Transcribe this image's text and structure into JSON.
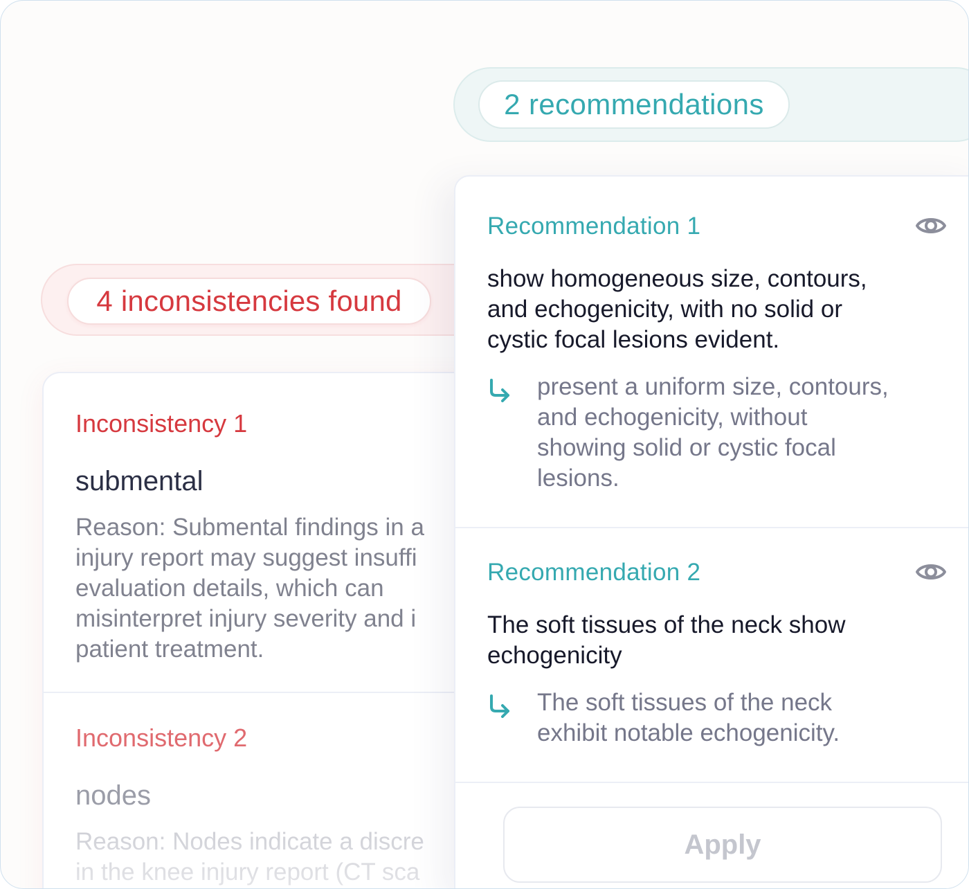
{
  "inconsistencies": {
    "badge": "4 inconsistencies found",
    "items": [
      {
        "title": "Inconsistency 1",
        "term": "submental",
        "reason_lines": [
          "Reason: Submental findings in a",
          "injury report may suggest insuffi",
          "evaluation details, which can",
          "misinterpret injury severity and i",
          "patient treatment."
        ]
      },
      {
        "title": "Inconsistency 2",
        "term": "nodes",
        "reason_lines": [
          "Reason: Nodes indicate a discre",
          "in the knee injury report (CT sca"
        ]
      }
    ]
  },
  "recommendations": {
    "badge": "2 recommendations",
    "items": [
      {
        "title": "Recommendation 1",
        "icon": "eye-icon",
        "original_lines": [
          "show homogeneous size, contours,",
          "and echogenicity, with no solid or",
          "cystic focal lesions evident."
        ],
        "suggestion_lines": [
          "present a uniform size, contours,",
          "and echogenicity, without",
          "showing solid or cystic focal",
          "lesions."
        ]
      },
      {
        "title": "Recommendation 2",
        "icon": "eye-icon",
        "original_lines": [
          "The soft tissues of the neck show",
          "echogenicity"
        ],
        "suggestion_lines": [
          "The soft tissues of the neck",
          "exhibit notable echogenicity."
        ]
      }
    ],
    "apply_label": "Apply"
  },
  "colors": {
    "inconsistency_accent": "#d6393f",
    "recommendation_accent": "#35a9b0"
  }
}
